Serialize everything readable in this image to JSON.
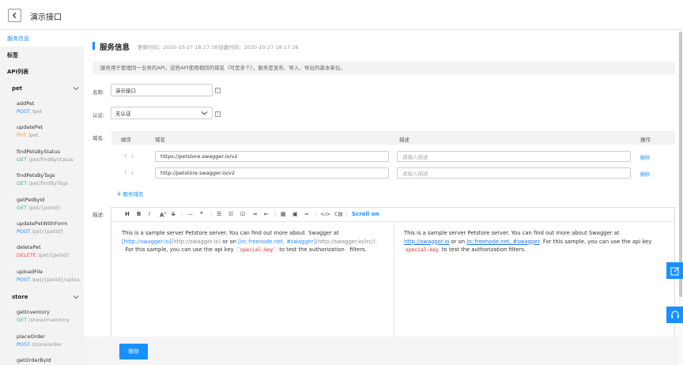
{
  "header": {
    "title": "演示接口"
  },
  "sidebar": {
    "active": "服务信息",
    "tags": "标签",
    "api_list": "API列表",
    "groups": [
      {
        "name": "pet",
        "items": [
          {
            "name": "addPet",
            "method": "POST",
            "path": "/pet"
          },
          {
            "name": "updatePet",
            "method": "PUT",
            "path": "/pet"
          },
          {
            "name": "findPetsByStatus",
            "method": "GET",
            "path": "/pet/findByStatus"
          },
          {
            "name": "findPetsByTags",
            "method": "GET",
            "path": "/pet/findByTags"
          },
          {
            "name": "getPetById",
            "method": "GET",
            "path": "/pet/{petId}"
          },
          {
            "name": "updatePetWithForm",
            "method": "POST",
            "path": "/pet/{petId}"
          },
          {
            "name": "deletePet",
            "method": "DELETE",
            "path": "/pet/{petId}"
          },
          {
            "name": "uploadFile",
            "method": "POST",
            "path": "/pet/{petId}/uploa..."
          }
        ]
      },
      {
        "name": "store",
        "items": [
          {
            "name": "getInventory",
            "method": "GET",
            "path": "/store/inventory"
          },
          {
            "name": "placeOrder",
            "method": "POST",
            "path": "/store/order"
          },
          {
            "name": "getOrderById",
            "method": "",
            "path": ""
          }
        ]
      }
    ]
  },
  "main": {
    "title": "服务信息",
    "updated": "更新时间：2020-10-27 18:17:38",
    "created": "创建时间：2020-10-27 18:17:38",
    "info": "服务用于管理同一业务的API，这些API使用相同的域名（可是多个），服务是发布、导入、导出的基本单位。",
    "name_label": "名称:",
    "name_value": "演示接口",
    "auth_label": "认证:",
    "auth_value": "无认证",
    "domain_label": "域名:",
    "table_headers": {
      "order": "顺序",
      "domain": "域名",
      "desc": "描述",
      "ops": "操作"
    },
    "domains": [
      {
        "url": "https://petstore.swagger.io/v2",
        "desc_placeholder": "请输入描述",
        "delete": "删除"
      },
      {
        "url": "http://petstore.swagger.io/v2",
        "desc_placeholder": "请输入描述",
        "delete": "删除"
      }
    ],
    "add_domain": "服务域名",
    "desc_label": "描述:",
    "toolbar": {
      "h": "H",
      "b": "B",
      "i": "I",
      "a": "A",
      "s": "S",
      "hr": "—",
      "quote": "❝",
      "scroll": "Scroll on"
    },
    "source": {
      "p1": "This is a sample server Petstore server. You can find out more about",
      "p2": "Swagger at",
      "link1": "[http://swagger.io]",
      "link1b": "(http://swagger.io)",
      "or_on": "or on",
      "link2": "[irc.freenode.net, #swagger]",
      "link2b": "(http://swagger.io/irc/).",
      "p3": "For this sample, you can use the api key",
      "code": "`special-key`",
      "p4": "to test the authorization",
      "p5": "filters."
    },
    "preview": {
      "p1": "This is a sample server Petstore server. You can find out more about Swagger at",
      "link1": "http://swagger.io",
      "or_on": "or on",
      "link2": "irc.freenode.net, #swagger",
      "p3": ". For this sample, you can use the api key",
      "code": "special-key",
      "p4": "to test the authorization filters."
    },
    "save": "保存"
  }
}
